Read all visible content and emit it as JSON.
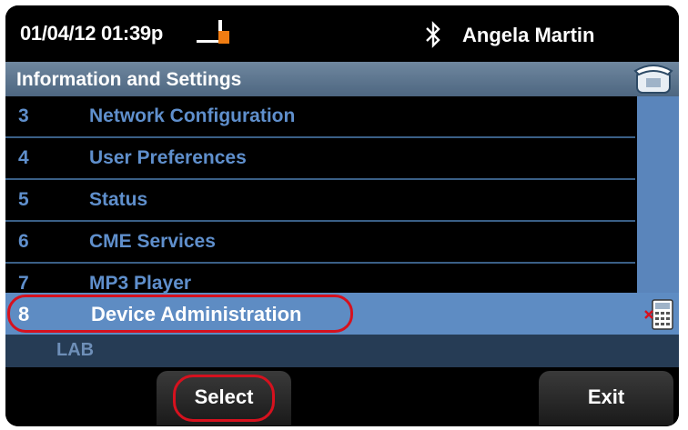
{
  "status": {
    "datetime": "01/04/12 01:39p",
    "user_name": "Angela Martin",
    "icons": [
      "line-status-icon",
      "bluetooth-icon"
    ]
  },
  "header": {
    "title": "Information and Settings",
    "icon": "phone-icon"
  },
  "menu": {
    "items": [
      {
        "number": "3",
        "label": "Network Configuration"
      },
      {
        "number": "4",
        "label": "User Preferences"
      },
      {
        "number": "5",
        "label": "Status"
      },
      {
        "number": "6",
        "label": "CME Services"
      },
      {
        "number": "7",
        "label": "MP3 Player"
      }
    ],
    "selected": {
      "number": "8",
      "label": "Device Administration",
      "icon": "keypad-icon"
    }
  },
  "info_strip": {
    "text": "LAB"
  },
  "softkeys": {
    "select_label": "Select",
    "exit_label": "Exit"
  },
  "colors": {
    "highlight": "#5e8cc3",
    "item_text": "#5f8fcc",
    "annotation": "#d6111e"
  }
}
